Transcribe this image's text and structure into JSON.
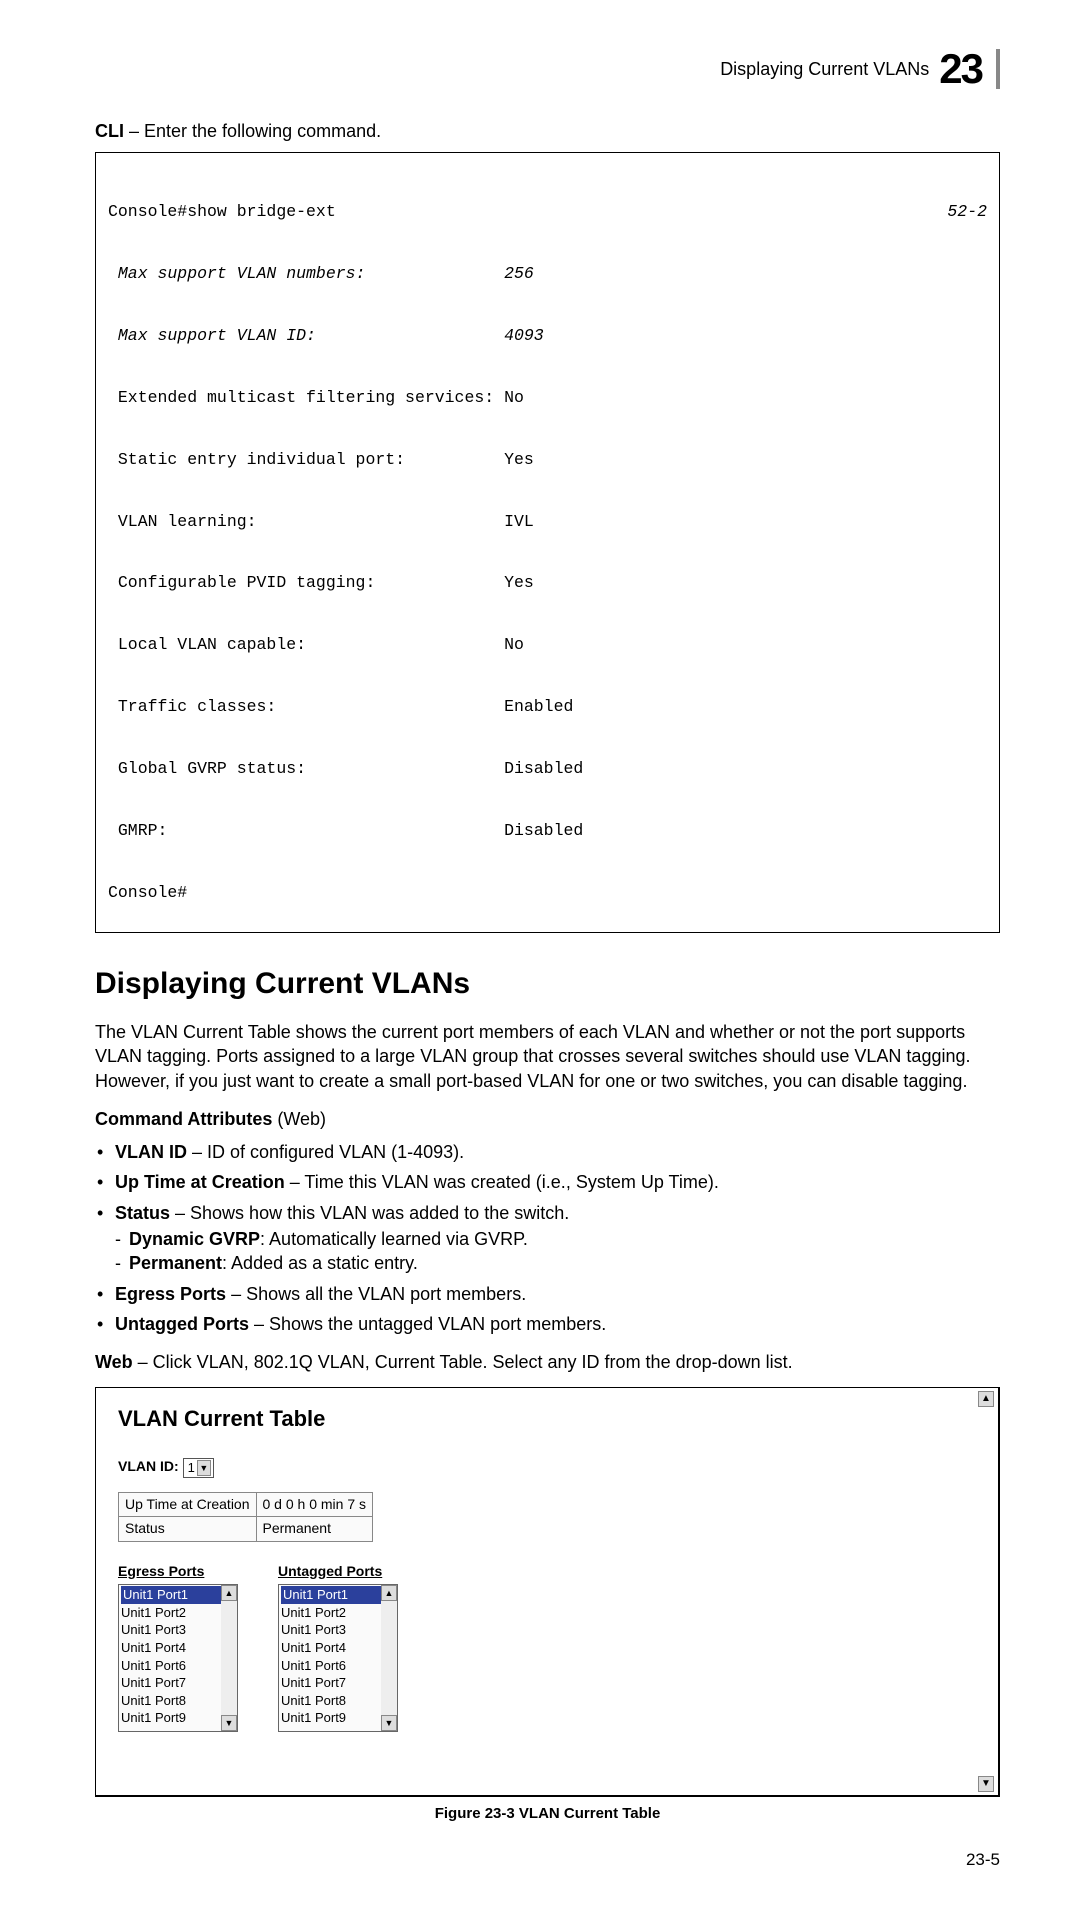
{
  "header": {
    "breadcrumb": "Displaying Current VLANs",
    "chapter": "23"
  },
  "cli_intro_bold": "CLI",
  "cli_intro_rest": " – Enter the following command.",
  "console": {
    "ref": "52-2",
    "lines": [
      "Console#show bridge-ext",
      " Max support VLAN numbers:              256",
      " Max support VLAN ID:                   4093",
      " Extended multicast filtering services: No",
      " Static entry individual port:          Yes",
      " VLAN learning:                         IVL",
      " Configurable PVID tagging:             Yes",
      " Local VLAN capable:                    No",
      " Traffic classes:                       Enabled",
      " Global GVRP status:                    Disabled",
      " GMRP:                                  Disabled",
      "Console#"
    ]
  },
  "section_title": "Displaying Current VLANs",
  "intro_para": "The VLAN Current Table shows the current port members of each VLAN and whether or not the port supports VLAN tagging. Ports assigned to a large VLAN group that crosses several switches should use VLAN tagging. However, if you just want to create a small port-based VLAN for one or two switches, you can disable tagging.",
  "attrs_head_bold": "Command Attributes",
  "attrs_head_rest": " (Web)",
  "bullets": [
    {
      "b": "VLAN ID",
      "t": " – ID of configured VLAN (1-4093)."
    },
    {
      "b": "Up Time at Creation",
      "t": " – Time this VLAN was created (i.e., System Up Time)."
    },
    {
      "b": "Status",
      "t": " – Shows how this VLAN was added to the switch.",
      "sub": [
        {
          "b": "Dynamic GVRP",
          "t": ": Automatically learned via GVRP."
        },
        {
          "b": "Permanent",
          "t": ": Added as a static entry."
        }
      ]
    },
    {
      "b": "Egress Ports",
      "t": " – Shows all the VLAN port members."
    },
    {
      "b": "Untagged Ports",
      "t": " – Shows the untagged VLAN port members."
    }
  ],
  "web_line_bold": "Web",
  "web_line_rest": " – Click VLAN, 802.1Q VLAN, Current Table. Select any ID from the drop-down list.",
  "screenshot": {
    "title": "VLAN Current Table",
    "vlan_id_label": "VLAN ID:",
    "vlan_id_value": "1",
    "info": [
      {
        "k": "Up Time at Creation",
        "v": "0 d 0 h 0 min 7 s"
      },
      {
        "k": "Status",
        "v": "Permanent"
      }
    ],
    "egress_label": "Egress Ports",
    "untagged_label": "Untagged Ports",
    "egress_ports": [
      "Unit1 Port1",
      "Unit1 Port2",
      "Unit1 Port3",
      "Unit1 Port4",
      "Unit1 Port6",
      "Unit1 Port7",
      "Unit1 Port8",
      "Unit1 Port9"
    ],
    "untagged_ports": [
      "Unit1 Port1",
      "Unit1 Port2",
      "Unit1 Port3",
      "Unit1 Port4",
      "Unit1 Port6",
      "Unit1 Port7",
      "Unit1 Port8",
      "Unit1 Port9"
    ]
  },
  "figure_caption": "Figure 23-3  VLAN Current Table",
  "page_number": "23-5"
}
